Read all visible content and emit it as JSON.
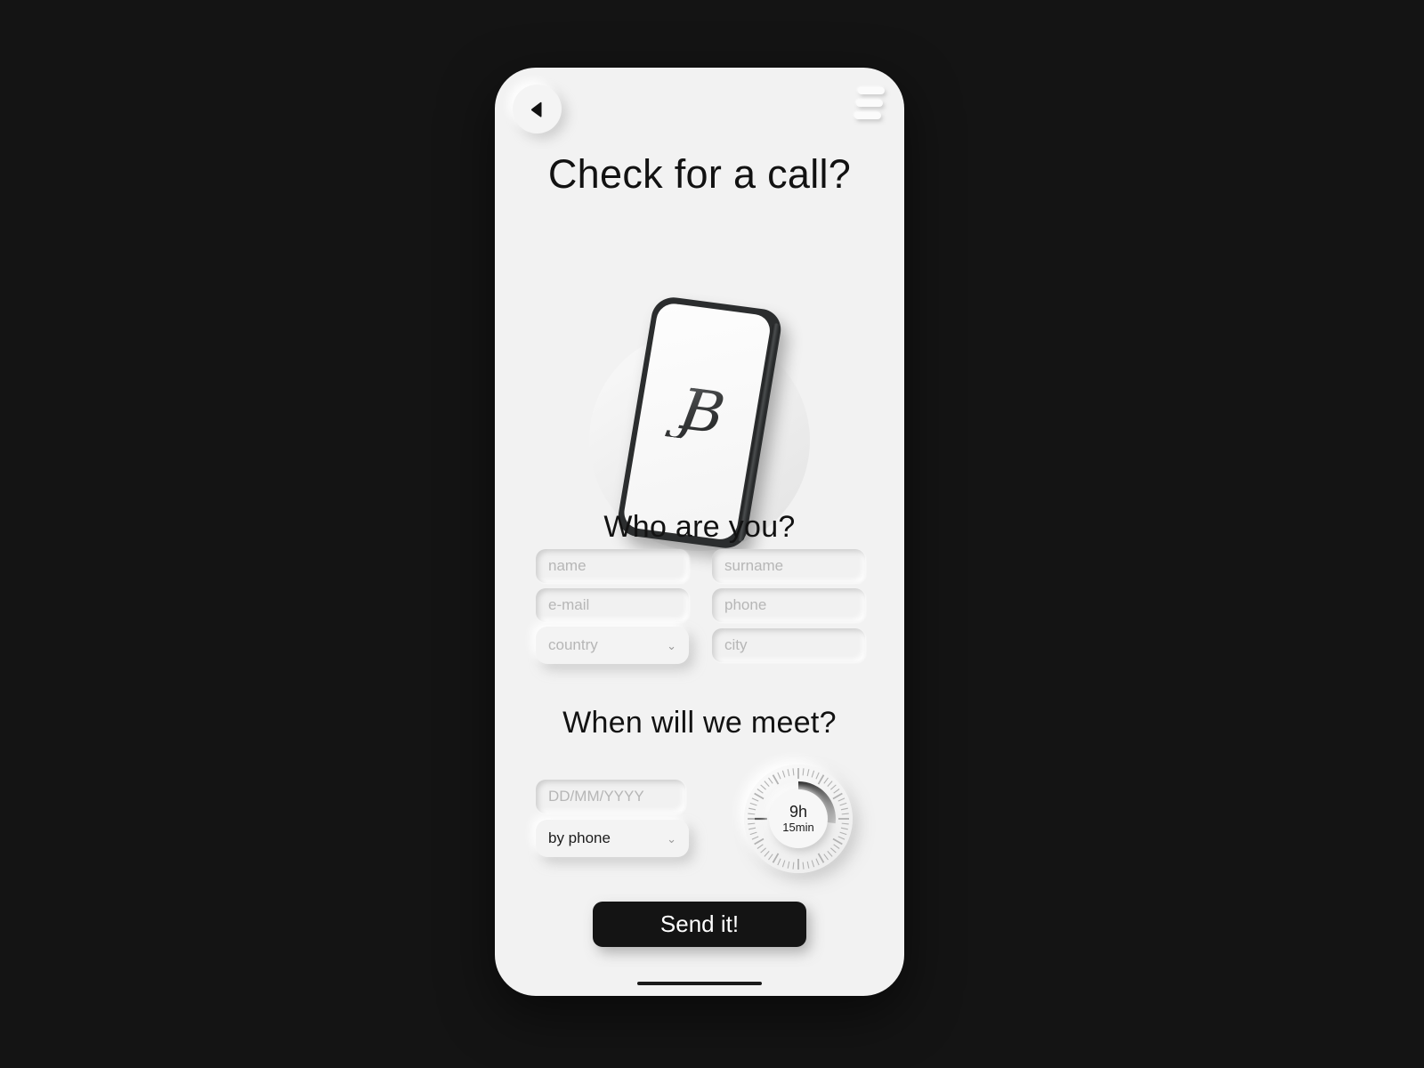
{
  "theme": {
    "page_background": "#141414",
    "phone_background": "#f2f2f2",
    "text_primary": "#121212",
    "text_placeholder": "#b6b6b6",
    "accent_button": "#141414",
    "accent_button_text": "#ffffff"
  },
  "header": {
    "back_icon": "back-triangle-icon",
    "menu_icon": "hamburger-menu-icon",
    "title": "Check for a call?"
  },
  "hero": {
    "illustration": "tilted-phone-illustration",
    "logo_text": "JB"
  },
  "sections": {
    "identity": {
      "title": "Who are you?",
      "fields": [
        {
          "name": "name-field",
          "placeholder": "name",
          "type": "text"
        },
        {
          "name": "surname-field",
          "placeholder": "surname",
          "type": "text"
        },
        {
          "name": "email-field",
          "placeholder": "e-mail",
          "type": "text"
        },
        {
          "name": "phone-field",
          "placeholder": "phone",
          "type": "text"
        },
        {
          "name": "city-field",
          "placeholder": "city",
          "type": "text"
        }
      ],
      "country_select": {
        "placeholder": "country",
        "value": "",
        "chevron": "⌄"
      }
    },
    "schedule": {
      "title": "When will we meet?",
      "date_field": {
        "placeholder": "DD/MM/YYYY",
        "value": ""
      },
      "method_select": {
        "value": "by phone",
        "chevron": "⌄"
      },
      "time_dial": {
        "hours_label": "9h",
        "minutes_label": "15min",
        "arc_start_deg": 0,
        "arc_end_deg": 97,
        "tick_count": 60
      }
    }
  },
  "footer": {
    "submit_label": "Send it!",
    "home_indicator": "home-indicator"
  }
}
